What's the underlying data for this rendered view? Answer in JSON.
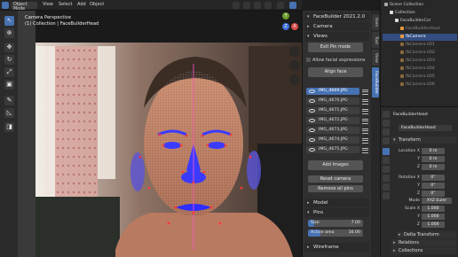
{
  "topbar": {
    "mode": "Object Mode",
    "menus": [
      "View",
      "Select",
      "Add",
      "Object"
    ]
  },
  "viewport": {
    "overlay_title": "Camera Perspective",
    "overlay_sub": "(1) Collection | FaceBuilderHead"
  },
  "npanel": {
    "header": "FaceBuilder 2021.2.0",
    "sections": {
      "camera": "Camera",
      "views": "Views",
      "model": "Model",
      "pins": "Pins",
      "wireframe": "Wireframe"
    },
    "exit_pin_mode": "Exit Pin mode",
    "allow_expressions": "Allow facial expressions",
    "align_face": "Align face",
    "cameras": [
      "IMG_4669.JPG",
      "IMG_4670.JPG",
      "IMG_4671.JPG",
      "IMG_4672.JPG",
      "IMG_4673.JPG",
      "IMG_4674.JPG",
      "IMG_4675.JPG"
    ],
    "add_images": "Add Images",
    "reset_camera": "Reset camera",
    "remove_pins": "Remove all pins",
    "size_label": "Size",
    "size_value": "7.00",
    "active_area_label": "Active area",
    "active_area_value": "16.00"
  },
  "vtabs": [
    "Item",
    "Tool",
    "View",
    "FaceBuilder"
  ],
  "outliner": {
    "rows": [
      "Scene Collection",
      "Collection",
      "FaceBuilderCol",
      "FaceBuilderHead",
      "fbCamera",
      "fbCamera.001",
      "fbCamera.002",
      "fbCamera.003",
      "fbCamera.004",
      "fbCamera.005",
      "fbCamera.006"
    ]
  },
  "properties": {
    "object_name": "FaceBuilderHead",
    "object_field": "FaceBuilderHead",
    "transform_header": "Transform",
    "location_label": "Location X",
    "rotation_label": "Rotation X",
    "scale_label": "Scale X",
    "axis_y": "Y",
    "axis_z": "Z",
    "mode_label": "Mode",
    "mode_value": "XYZ Euler",
    "location": [
      "0 m",
      "0 m",
      "0 m"
    ],
    "rotation": [
      "0°",
      "0°",
      "0°"
    ],
    "scale": [
      "1.000",
      "1.000",
      "1.000"
    ],
    "delta_transform": "Delta Transform",
    "relations": "Relations",
    "collections": "Collections"
  },
  "colors": {
    "accent": "#4772b3",
    "wire": "#c95aa8",
    "pin": "#ff3838",
    "face_blue": "#3b3bff"
  }
}
